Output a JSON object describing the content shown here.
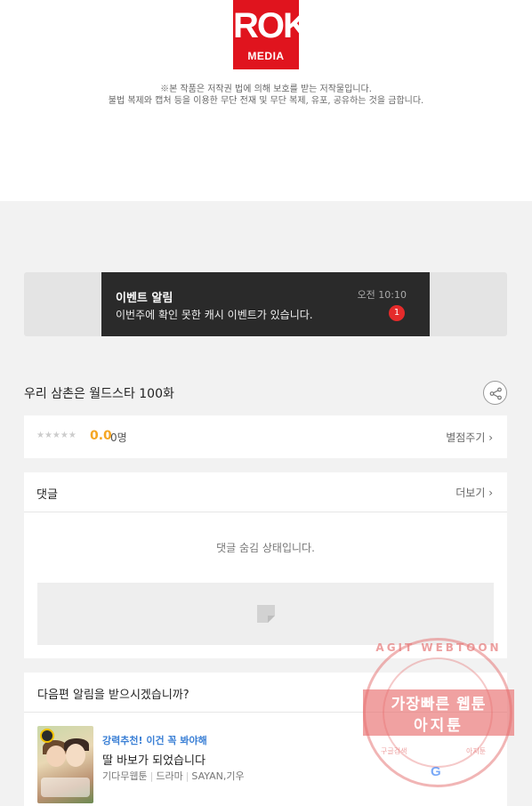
{
  "header": {
    "logo_text": "ROK",
    "logo_sub": "MEDIA",
    "notice_line1": "※본 작품은 저작권 법에 의해 보호를 받는 저작물입니다.",
    "notice_line2": "불법 복제와 캡처 등을 이용한 무단 전재 및 무단 복제, 유포, 공유하는 것을 금합니다."
  },
  "event": {
    "title": "이벤트 알림",
    "message": "이번주에 확인 못한 캐시 이벤트가 있습니다.",
    "time": "오전 10:10",
    "badge": "1"
  },
  "episode": {
    "title": "우리 삼촌은 월드스타 100화",
    "share_icon": "share-icon"
  },
  "rating": {
    "stars": "★★★★★",
    "score": "0.0",
    "count": "0명",
    "rate_link": "별점주기 ›"
  },
  "comments": {
    "label": "댓글",
    "more": "더보기 ›",
    "hidden_message": "댓글 숨김 상태입니다."
  },
  "next_episode": {
    "question": "다음편 알림을 받으시겠습니까?",
    "recommend_tag": "강력추천! 이건 꼭 봐야해",
    "recommend_title": "딸 바보가 되었습니다",
    "meta_platform": "기다무웹툰",
    "meta_genre": "드라마",
    "meta_author": "SAYAN,기우"
  },
  "watermark": {
    "arc_text": "AGIT WEBTOON",
    "line1": "가장빠른 웹툰",
    "line2": "아지툰",
    "small_left": "구글검색",
    "small_right": "아지툰",
    "google": "G"
  }
}
